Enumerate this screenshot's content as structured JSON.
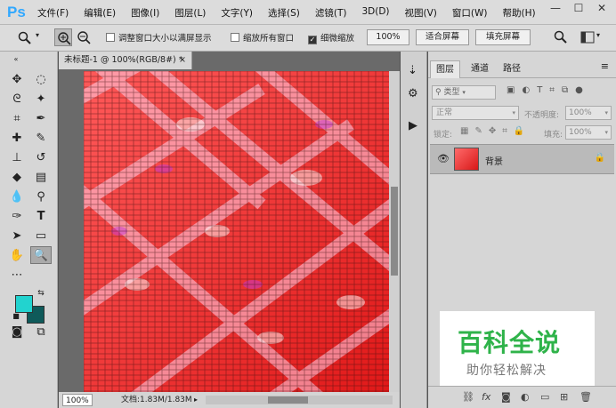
{
  "app": {
    "logo": "Ps"
  },
  "menubar": {
    "items": [
      "文件(F)",
      "编辑(E)",
      "图像(I)",
      "图层(L)",
      "文字(Y)",
      "选择(S)",
      "滤镜(T)",
      "3D(D)",
      "视图(V)",
      "窗口(W)",
      "帮助(H)"
    ],
    "window_buttons": [
      "—",
      "☐",
      "✕"
    ]
  },
  "options": {
    "resize_windows": "调整窗口大小以满屏显示",
    "zoom_all": "缩放所有窗口",
    "scrubby_zoom": "细微缩放",
    "zoom_value": "100%",
    "fit_screen": "适合屏幕",
    "fill_screen": "填充屏幕"
  },
  "document": {
    "tab_title": "未标题-1 @ 100%(RGB/8#) *",
    "zoom": "100%",
    "doc_info": "文档:1.83M/1.83M"
  },
  "layers_panel": {
    "tabs": [
      "图层",
      "通道",
      "路径"
    ],
    "filter_kind": "类型",
    "blend_mode": "正常",
    "opacity_label": "不透明度:",
    "opacity_value": "100%",
    "lock_label": "锁定:",
    "fill_label": "填充:",
    "fill_value": "100%",
    "layers": [
      {
        "name": "背景",
        "visible": true,
        "locked": true
      }
    ]
  },
  "colors": {
    "foreground": "#22d3cf",
    "background": "#0f5a5a",
    "ps_blue": "#31a8ff"
  },
  "watermark": {
    "title": "百科全说",
    "subtitle": "助你轻松解决"
  }
}
